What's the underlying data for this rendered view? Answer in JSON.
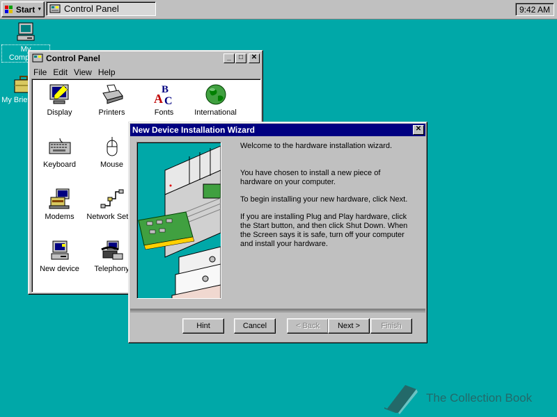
{
  "taskbar": {
    "start_label": "Start",
    "task_label": "Control Panel",
    "clock": "9:42 AM"
  },
  "desktop": {
    "icons": [
      {
        "label": "My Computer",
        "icon": "computer-icon"
      },
      {
        "label": "My Briefcase",
        "icon": "briefcase-icon"
      }
    ]
  },
  "control_panel": {
    "title": "Control Panel",
    "menu": [
      "File",
      "Edit",
      "View",
      "Help"
    ],
    "items": [
      {
        "label": "Display",
        "icon": "display-icon"
      },
      {
        "label": "Printers",
        "icon": "printer-icon"
      },
      {
        "label": "Fonts",
        "icon": "fonts-icon"
      },
      {
        "label": "International",
        "icon": "globe-icon"
      },
      {
        "label": "Keyboard",
        "icon": "keyboard-icon"
      },
      {
        "label": "Mouse",
        "icon": "mouse-icon"
      },
      {
        "label": "Modems",
        "icon": "modem-icon"
      },
      {
        "label": "Network Setup",
        "icon": "network-icon"
      },
      {
        "label": "New device",
        "icon": "new-device-icon"
      },
      {
        "label": "Telephony",
        "icon": "telephony-icon"
      }
    ]
  },
  "wizard": {
    "title": "New Device Installation Wizard",
    "paragraphs": [
      "Welcome to the hardware installation wizard.",
      "You have chosen to install a new piece of hardware on your computer.",
      "To begin installing your new hardware, click Next.",
      "If you are installing Plug and Play hardware, click the Start button, and then click Shut Down.  When the Screen says it is safe, turn off your computer and install your hardware."
    ],
    "buttons": {
      "hint": "Hint",
      "cancel": "Cancel",
      "back": "< Back",
      "next": "Next >",
      "finish": "Finish"
    }
  },
  "watermark": "The Collection Book",
  "colors": {
    "desktop": "#00a8a8",
    "active_title": "#000080",
    "face": "#c0c0c0"
  }
}
